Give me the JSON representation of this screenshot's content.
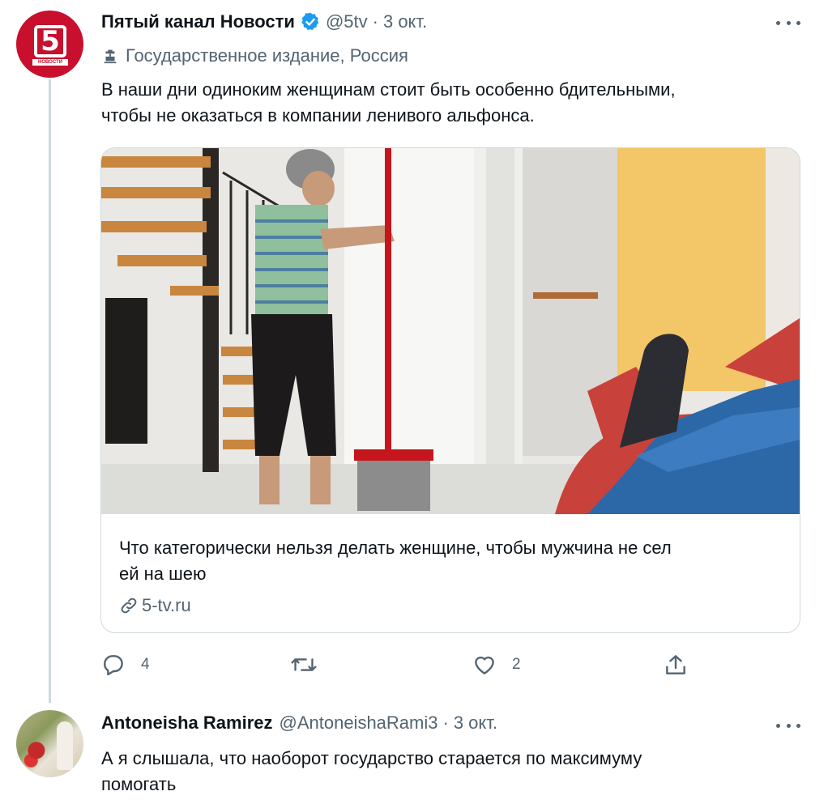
{
  "tweet": {
    "author_name": "Пятый канал Новости",
    "handle": "@5tv",
    "separator": "·",
    "date": "3 окт.",
    "label": "Государственное издание, Россия",
    "text_line1": "В наши дни одиноким женщинам стоит быть особенно бдительными,",
    "text_line2": "чтобы не оказаться в компании ленивого альфонса.",
    "avatar_text": "5",
    "avatar_sub": "НОВОСТИ",
    "card": {
      "title_line1": "Что категорически нельзя делать женщине, чтобы мужчина не сел",
      "title_line2": "ей на шею",
      "domain": "5-tv.ru"
    },
    "actions": {
      "reply_count": "4",
      "retweet_count": "",
      "like_count": "2"
    }
  },
  "reply": {
    "author_name": "Antoneisha Ramirez",
    "handle": "@AntoneishaRami3",
    "separator": "·",
    "date": "3 окт.",
    "text_line1": "А я слышала, что наоборот государство старается по максимуму",
    "text_line2": "помогать"
  },
  "colors": {
    "brand_red": "#c8102e",
    "verified_blue": "#1d9bf0",
    "muted": "#536471",
    "text": "#0f1419",
    "border": "#cfd9de"
  },
  "icons": {
    "verified": "verified-badge-icon",
    "label": "state-media-icon",
    "more": "more-icon",
    "link": "link-icon",
    "reply": "reply-icon",
    "retweet": "retweet-icon",
    "like": "heart-icon",
    "share": "share-icon"
  }
}
